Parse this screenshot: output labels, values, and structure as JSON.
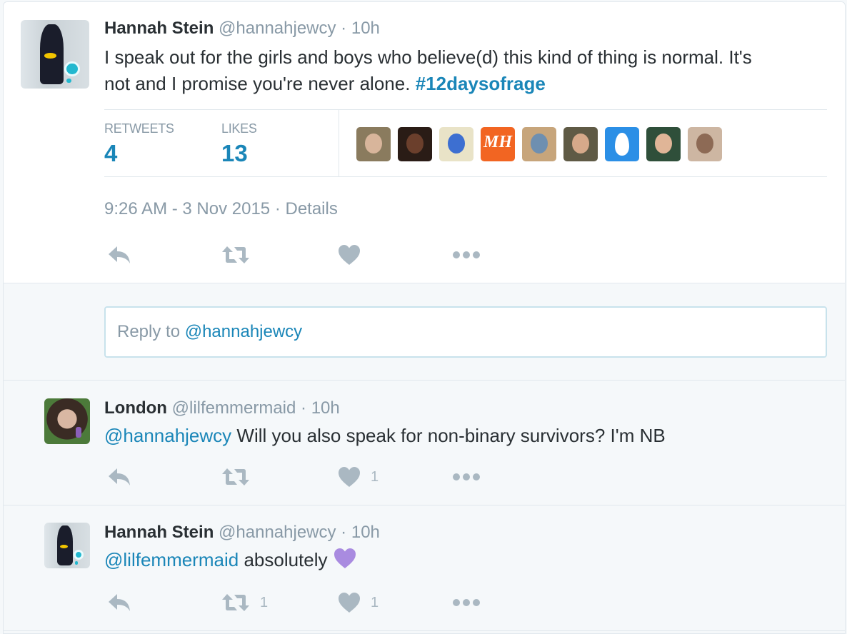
{
  "main_tweet": {
    "name": "Hannah Stein",
    "handle": "@hannahjewcy",
    "separator": "·",
    "time": "10h",
    "text_part1": "I speak out for the girls and boys who believe(d) this kind of thing is normal. It's",
    "text_part2": "not and I promise you're never alone.",
    "hashtag": "#12daysofrage",
    "retweets_label": "RETWEETS",
    "retweets_count": "4",
    "likes_label": "LIKES",
    "likes_count": "13",
    "liker_avatars": [
      {
        "icon": "liker-avatar-1",
        "bg": "#8a7b5e",
        "face": "#d8b59b"
      },
      {
        "icon": "liker-avatar-2",
        "bg": "#2a1c16",
        "face": "#6b3f2c"
      },
      {
        "icon": "liker-avatar-3",
        "bg": "#e9e3c7",
        "face": "#3d6fd1"
      },
      {
        "icon": "liker-avatar-mh-logo",
        "bg": "#f26522",
        "text": "MH"
      },
      {
        "icon": "liker-avatar-5",
        "bg": "#c7a57b",
        "face": "#6e8fb0"
      },
      {
        "icon": "liker-avatar-6",
        "bg": "#5f5a45",
        "face": "#d6a98a"
      },
      {
        "icon": "liker-avatar-egg",
        "bg": "#2b8fe6",
        "face": "#ffffff"
      },
      {
        "icon": "liker-avatar-8",
        "bg": "#2f4f3a",
        "face": "#e0b597"
      },
      {
        "icon": "liker-avatar-9",
        "bg": "#cdb6a2",
        "face": "#8d6a55"
      }
    ],
    "timestamp": "9:26 AM - 3 Nov 2015",
    "details_sep": "·",
    "details": "Details"
  },
  "reply_box": {
    "prefix": "Reply to",
    "mention": "@hannahjewcy"
  },
  "replies": [
    {
      "name": "London",
      "handle": "@lilfemmermaid",
      "separator": "·",
      "time": "10h",
      "mention": "@hannahjewcy",
      "text": "Will you also speak for non-binary survivors? I'm NB",
      "retweet_count": "",
      "like_count": "1"
    },
    {
      "name": "Hannah Stein",
      "handle": "@hannahjewcy",
      "separator": "·",
      "time": "10h",
      "mention": "@lilfemmermaid",
      "text": "absolutely",
      "emoji": "purple-heart",
      "retweet_count": "1",
      "like_count": "1"
    }
  ],
  "colors": {
    "link": "#1a86b8",
    "muted": "#8899a6",
    "icon": "#aab8c2",
    "emoji_heart": "#a98be0"
  }
}
